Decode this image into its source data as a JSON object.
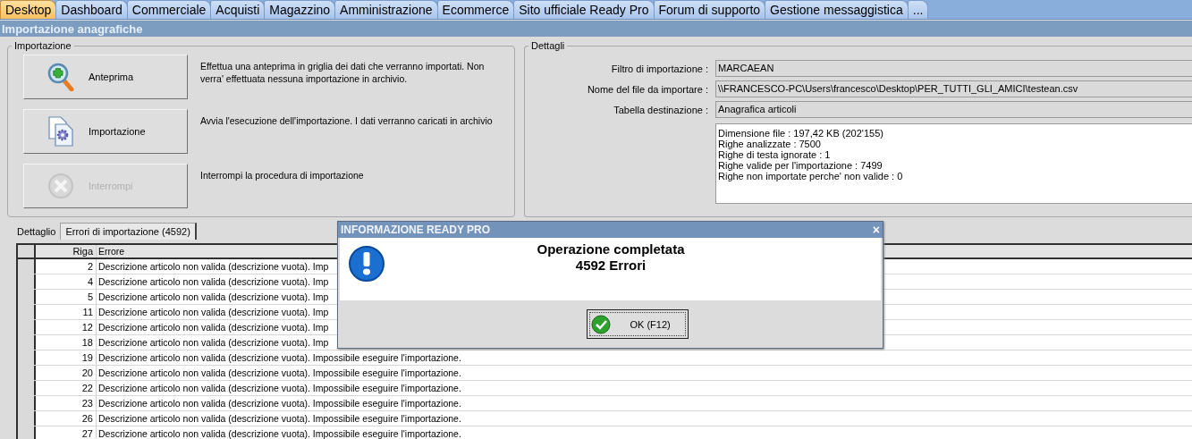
{
  "tabs": [
    {
      "label": "Desktop",
      "selected": true
    },
    {
      "label": "Dashboard",
      "selected": false
    },
    {
      "label": "Commerciale",
      "selected": false
    },
    {
      "label": "Acquisti",
      "selected": false
    },
    {
      "label": "Magazzino",
      "selected": false
    },
    {
      "label": "Amministrazione",
      "selected": false
    },
    {
      "label": "Ecommerce",
      "selected": false
    },
    {
      "label": "Sito ufficiale Ready Pro",
      "selected": false
    },
    {
      "label": "Forum di supporto",
      "selected": false
    },
    {
      "label": "Gestione messaggistica",
      "selected": false
    },
    {
      "label": "...",
      "selected": false
    }
  ],
  "section_title": "Importazione anagrafiche",
  "import_group": {
    "title": "Importazione",
    "actions": [
      {
        "kind": "preview",
        "label": "Anteprima",
        "disabled": false,
        "description": "Effettua una anteprima in griglia dei dati che verranno importati. Non verra' effettuata nessuna importazione in archivio."
      },
      {
        "kind": "import",
        "label": "Importazione",
        "disabled": false,
        "description": "Avvia l'esecuzione dell'importazione. I dati verranno caricati in archivio"
      },
      {
        "kind": "stop",
        "label": "Interrompi",
        "disabled": true,
        "description": "Interrompi la procedura di importazione"
      }
    ]
  },
  "details": {
    "title": "Dettagli",
    "fields": [
      {
        "label": "Filtro di importazione :",
        "value": "MARCAEAN"
      },
      {
        "label": "Nome del file da importare :",
        "value": "\\\\FRANCESCO-PC\\Users\\francesco\\Desktop\\PER_TUTTI_GLI_AMICI\\testean.csv"
      },
      {
        "label": "Tabella destinazione :",
        "value": "Anagrafica articoli"
      }
    ],
    "summary": [
      "Dimensione file : 197,42 KB (202'155)",
      "Righe analizzate : 7500",
      "Righe di testa ignorate : 1",
      "Righe valide per l'importazione : 7499",
      "Righe non importate perche' non valide : 0"
    ]
  },
  "bottom_tabs": [
    {
      "label": "Dettaglio",
      "selected": false
    },
    {
      "label": "Errori di importazione (4592)",
      "selected": true
    }
  ],
  "error_table": {
    "columns": [
      "Riga",
      "Errore"
    ],
    "rows": [
      {
        "riga": "2",
        "errore": "Descrizione articolo non valida (descrizione vuota). Imp"
      },
      {
        "riga": "4",
        "errore": "Descrizione articolo non valida (descrizione vuota). Imp"
      },
      {
        "riga": "5",
        "errore": "Descrizione articolo non valida (descrizione vuota). Imp"
      },
      {
        "riga": "11",
        "errore": "Descrizione articolo non valida (descrizione vuota). Imp"
      },
      {
        "riga": "12",
        "errore": "Descrizione articolo non valida (descrizione vuota). Imp"
      },
      {
        "riga": "18",
        "errore": "Descrizione articolo non valida (descrizione vuota). Imp"
      },
      {
        "riga": "19",
        "errore": "Descrizione articolo non valida (descrizione vuota). Impossibile eseguire l'importazione."
      },
      {
        "riga": "20",
        "errore": "Descrizione articolo non valida (descrizione vuota). Impossibile eseguire l'importazione."
      },
      {
        "riga": "22",
        "errore": "Descrizione articolo non valida (descrizione vuota). Impossibile eseguire l'importazione."
      },
      {
        "riga": "23",
        "errore": "Descrizione articolo non valida (descrizione vuota). Impossibile eseguire l'importazione."
      },
      {
        "riga": "26",
        "errore": "Descrizione articolo non valida (descrizione vuota). Impossibile eseguire l'importazione."
      },
      {
        "riga": "27",
        "errore": "Descrizione articolo non valida (descrizione vuota). Impossibile eseguire l'importazione."
      }
    ]
  },
  "dialog": {
    "title": "INFORMAZIONE READY PRO",
    "close": "×",
    "message": [
      "Operazione completata",
      "4592 Errori"
    ],
    "button": "OK (F12)"
  }
}
